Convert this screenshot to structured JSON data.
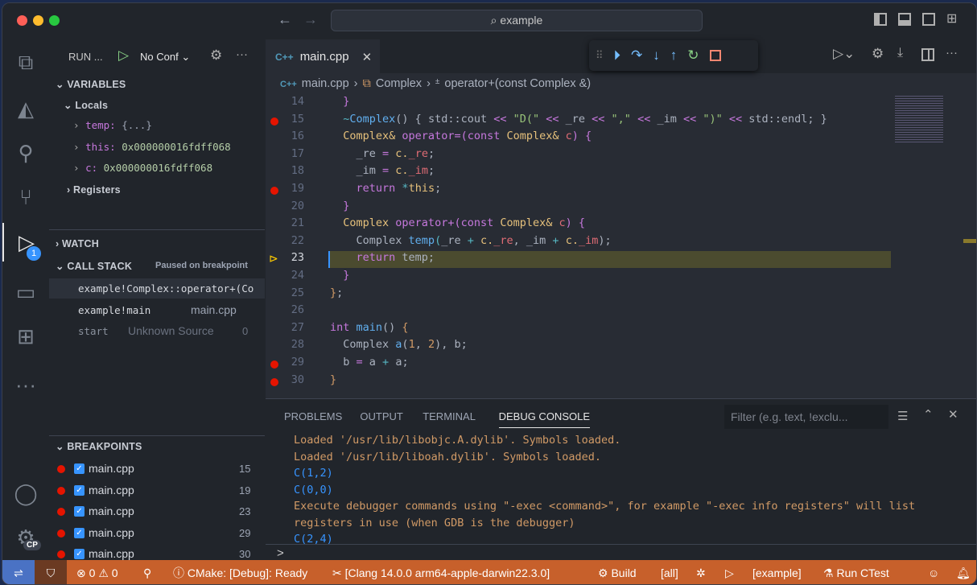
{
  "window": {
    "search": "example"
  },
  "sidebar": {
    "run_label": "RUN ...",
    "config": "No Conf",
    "variables_title": "VARIABLES",
    "locals": "Locals",
    "variables": [
      {
        "name": "temp:",
        "value": "{...}"
      },
      {
        "name": "this:",
        "value": "0x000000016fdff068"
      },
      {
        "name": "c:",
        "value": "0x000000016fdff068"
      }
    ],
    "registers": "Registers",
    "watch": "WATCH",
    "callstack_title": "CALL STACK",
    "callstack_status": "Paused on breakpoint",
    "frames": [
      {
        "name": "example!Complex::operator+(Co",
        "source": ""
      },
      {
        "name": "example!main",
        "source": "main.cpp"
      },
      {
        "name": "start",
        "source": "Unknown Source",
        "line": "0"
      }
    ],
    "breakpoints_title": "BREAKPOINTS",
    "breakpoints": [
      {
        "file": "main.cpp",
        "line": "15"
      },
      {
        "file": "main.cpp",
        "line": "19"
      },
      {
        "file": "main.cpp",
        "line": "23"
      },
      {
        "file": "main.cpp",
        "line": "29"
      },
      {
        "file": "main.cpp",
        "line": "30"
      }
    ],
    "debug_badge": "1",
    "account_badge": "CP"
  },
  "editor": {
    "tab": "main.cpp",
    "tab_icon": "C++",
    "breadcrumb": [
      "main.cpp",
      "Complex",
      "operator+(const Complex &)"
    ],
    "current_line": 23,
    "breakpoint_lines": [
      15,
      19,
      23,
      29,
      30
    ],
    "lines": [
      {
        "n": 14,
        "tokens": [
          [
            "  ",
            "d"
          ],
          [
            "}",
            "k"
          ]
        ]
      },
      {
        "n": 15,
        "tokens": [
          [
            "  ~",
            "o"
          ],
          [
            "Complex",
            "f"
          ],
          [
            "() { ",
            "d"
          ],
          [
            "std::cout ",
            "d"
          ],
          [
            "<< ",
            "k"
          ],
          [
            "\"D(\" ",
            "s"
          ],
          [
            "<< ",
            "k"
          ],
          [
            "_re ",
            "d"
          ],
          [
            "<< ",
            "k"
          ],
          [
            "\",\" ",
            "s"
          ],
          [
            "<< ",
            "k"
          ],
          [
            "_im ",
            "d"
          ],
          [
            "<< ",
            "k"
          ],
          [
            "\")\" ",
            "s"
          ],
          [
            "<< ",
            "k"
          ],
          [
            "std::endl; }",
            "d"
          ]
        ]
      },
      {
        "n": 16,
        "tokens": [
          [
            "  ",
            "d"
          ],
          [
            "Complex& ",
            "t"
          ],
          [
            "operator=",
            "k"
          ],
          [
            "(",
            "k"
          ],
          [
            "const ",
            "k"
          ],
          [
            "Complex& ",
            "t"
          ],
          [
            "c",
            "v"
          ],
          [
            ") {",
            "k"
          ]
        ]
      },
      {
        "n": 17,
        "tokens": [
          [
            "    _re ",
            "d"
          ],
          [
            "= ",
            "k"
          ],
          [
            "c.",
            "t"
          ],
          [
            "_re",
            "v"
          ],
          [
            ";",
            "d"
          ]
        ]
      },
      {
        "n": 18,
        "tokens": [
          [
            "    _im ",
            "d"
          ],
          [
            "= ",
            "k"
          ],
          [
            "c.",
            "t"
          ],
          [
            "_im",
            "v"
          ],
          [
            ";",
            "d"
          ]
        ]
      },
      {
        "n": 19,
        "tokens": [
          [
            "    ",
            "d"
          ],
          [
            "return ",
            "k"
          ],
          [
            "*",
            "o"
          ],
          [
            "this",
            "t"
          ],
          [
            ";",
            "d"
          ]
        ]
      },
      {
        "n": 20,
        "tokens": [
          [
            "  ",
            "d"
          ],
          [
            "}",
            "k"
          ]
        ]
      },
      {
        "n": 21,
        "tokens": [
          [
            "  ",
            "d"
          ],
          [
            "Complex ",
            "t"
          ],
          [
            "operator+",
            "k"
          ],
          [
            "(const ",
            "k"
          ],
          [
            "Complex& ",
            "t"
          ],
          [
            "c",
            "v"
          ],
          [
            ") ",
            "k"
          ],
          [
            "{",
            "k"
          ]
        ]
      },
      {
        "n": 22,
        "tokens": [
          [
            "    Complex ",
            "d"
          ],
          [
            "temp",
            "f"
          ],
          [
            "(",
            "o"
          ],
          [
            "_re ",
            "d"
          ],
          [
            "+ ",
            "o"
          ],
          [
            "c.",
            "t"
          ],
          [
            "_re",
            "v"
          ],
          [
            ", _im ",
            "d"
          ],
          [
            "+ ",
            "o"
          ],
          [
            "c.",
            "t"
          ],
          [
            "_im",
            "v"
          ],
          [
            ");",
            "d"
          ]
        ]
      },
      {
        "n": 23,
        "tokens": [
          [
            "    ",
            "d"
          ],
          [
            "return ",
            "k"
          ],
          [
            "temp;",
            "d"
          ]
        ]
      },
      {
        "n": 24,
        "tokens": [
          [
            "  ",
            "d"
          ],
          [
            "}",
            "k"
          ]
        ]
      },
      {
        "n": 25,
        "tokens": [
          [
            "}",
            "n"
          ],
          [
            ";",
            "d"
          ]
        ]
      },
      {
        "n": 26,
        "tokens": []
      },
      {
        "n": 27,
        "tokens": [
          [
            "int ",
            "k"
          ],
          [
            "main",
            "f"
          ],
          [
            "() ",
            "d"
          ],
          [
            "{",
            "n"
          ]
        ]
      },
      {
        "n": 28,
        "tokens": [
          [
            "  Complex ",
            "d"
          ],
          [
            "a",
            "f"
          ],
          [
            "(",
            "d"
          ],
          [
            "1",
            "n"
          ],
          [
            ", ",
            "d"
          ],
          [
            "2",
            "n"
          ],
          [
            "), b;",
            "d"
          ]
        ]
      },
      {
        "n": 29,
        "tokens": [
          [
            "  b ",
            "d"
          ],
          [
            "= ",
            "k"
          ],
          [
            "a ",
            "d"
          ],
          [
            "+ ",
            "o"
          ],
          [
            "a;",
            "d"
          ]
        ]
      },
      {
        "n": 30,
        "tokens": [
          [
            "}",
            "n"
          ]
        ]
      }
    ]
  },
  "panel": {
    "tabs": [
      "PROBLEMS",
      "OUTPUT",
      "TERMINAL",
      "DEBUG CONSOLE"
    ],
    "active_tab": "DEBUG CONSOLE",
    "filter_placeholder": "Filter (e.g. text, !exclu...",
    "console": [
      {
        "text": "Loaded '/usr/lib/libobjc.A.dylib'. Symbols loaded.",
        "kind": "info"
      },
      {
        "text": "Loaded '/usr/lib/liboah.dylib'. Symbols loaded.",
        "kind": "info"
      },
      {
        "text": "C(1,2)",
        "kind": "out"
      },
      {
        "text": "C(0,0)",
        "kind": "out"
      },
      {
        "text": "Execute debugger commands using \"-exec <command>\", for example \"-exec info registers\" will list",
        "kind": "info"
      },
      {
        "text": "registers in use (when GDB is the debugger)",
        "kind": "info"
      },
      {
        "text": "C(2,4)",
        "kind": "out"
      }
    ],
    "prompt": ">"
  },
  "status": {
    "errors": "0",
    "warnings": "0",
    "cmake": "CMake: [Debug]: Ready",
    "kit": "[Clang 14.0.0 arm64-apple-darwin22.3.0]",
    "build": "Build",
    "target": "[all]",
    "launch_target": "[example]",
    "ctest": "Run CTest",
    "color": "#c7602b"
  }
}
